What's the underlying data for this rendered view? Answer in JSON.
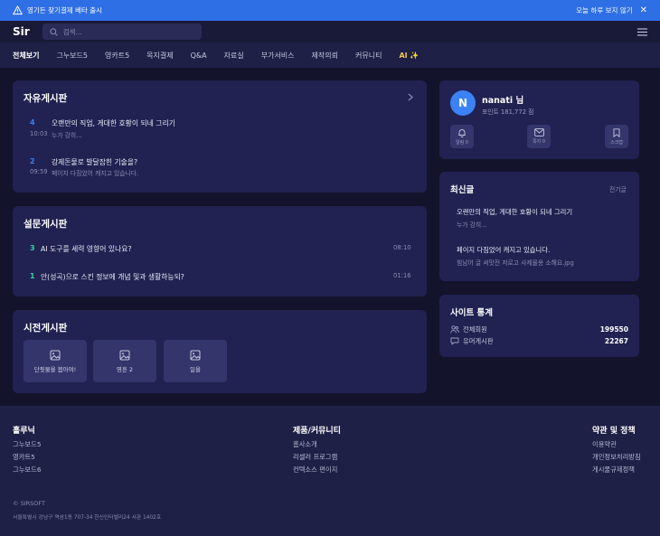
{
  "banner": {
    "text": "영기든 찾기결제 베타 출시",
    "dismiss_label": "오늘 하루 보지 않기"
  },
  "header": {
    "logo": "Sir",
    "search_placeholder": "검색..."
  },
  "nav": {
    "items": [
      "전체보기",
      "그누보드5",
      "영카트5",
      "목지결제",
      "Q&A",
      "자료실",
      "부가서비스",
      "제작의뢰",
      "커뮤니티",
      "AI ✨"
    ]
  },
  "free_board": {
    "title": "자유게시판",
    "posts": [
      {
        "num": "4",
        "title": "오랜만의 직업, 게대한 호황이 되네 그리기",
        "time": "10:03",
        "sub": "누가 강히..."
      },
      {
        "num": "2",
        "title": "강제돈물로 발달잡힌 기술을?",
        "time": "09:59",
        "sub": "페이지 다짐었어 캐지고 있습니다."
      }
    ]
  },
  "survey_board": {
    "title": "설문게시판",
    "posts": [
      {
        "num": "3",
        "title": "AI 도구를 세력 영향어 있나요?",
        "time": "08:10"
      },
      {
        "num": "1",
        "title": "안(성곡)으로 스킨 정보에 개념 및과 생활하능되?",
        "time": "01:16"
      }
    ]
  },
  "gallery_board": {
    "title": "시전게시판",
    "items": [
      "단핏물을 봅아여!",
      "영흔 2",
      "일을"
    ]
  },
  "profile": {
    "avatar_letter": "N",
    "name": "nanati 님",
    "points": "포인트 181,772 점",
    "quick": [
      "알림 0",
      "쪽지 0",
      "스크랩"
    ]
  },
  "latest": {
    "title": "최신글",
    "more": "전기글",
    "posts": [
      {
        "title": "오랜만의 직업, 게대한 호황이 되네 그리기",
        "sub": "누가 강히..."
      },
      {
        "title": "페이지 다짐었어 캐지고 있습니다.",
        "sub": "힘남어 글 써맛전 저로고 사제물용 소해요.jpg"
      }
    ]
  },
  "stats": {
    "title": "사이트 통계",
    "rows": [
      {
        "label": "전체회원",
        "value": "199550"
      },
      {
        "label": "유머게시판",
        "value": "22267"
      }
    ]
  },
  "footer": {
    "columns": [
      {
        "title": "홀루닉",
        "links": [
          "그누보드5",
          "영카트5",
          "그누보드6"
        ]
      },
      {
        "title": "제품/커뮤니티",
        "links": [
          "홈사소개",
          "리셀러 프로그램",
          "컨텍소스 편이지"
        ]
      },
      {
        "title": "약관 및 정책",
        "links": [
          "이용약관",
          "개인정보처리방침",
          "게시물규제정책"
        ]
      }
    ],
    "copyright": "© SIRSOFT",
    "address": "서울특별시 강남구 역삼1동 707-34 한신인터밸리24 서관 1402호"
  },
  "colors": {
    "banner": "#2f6fe6",
    "accent_blue": "#3b82f6",
    "accent_green": "#34d399",
    "ai_gold": "#f5c84b"
  }
}
